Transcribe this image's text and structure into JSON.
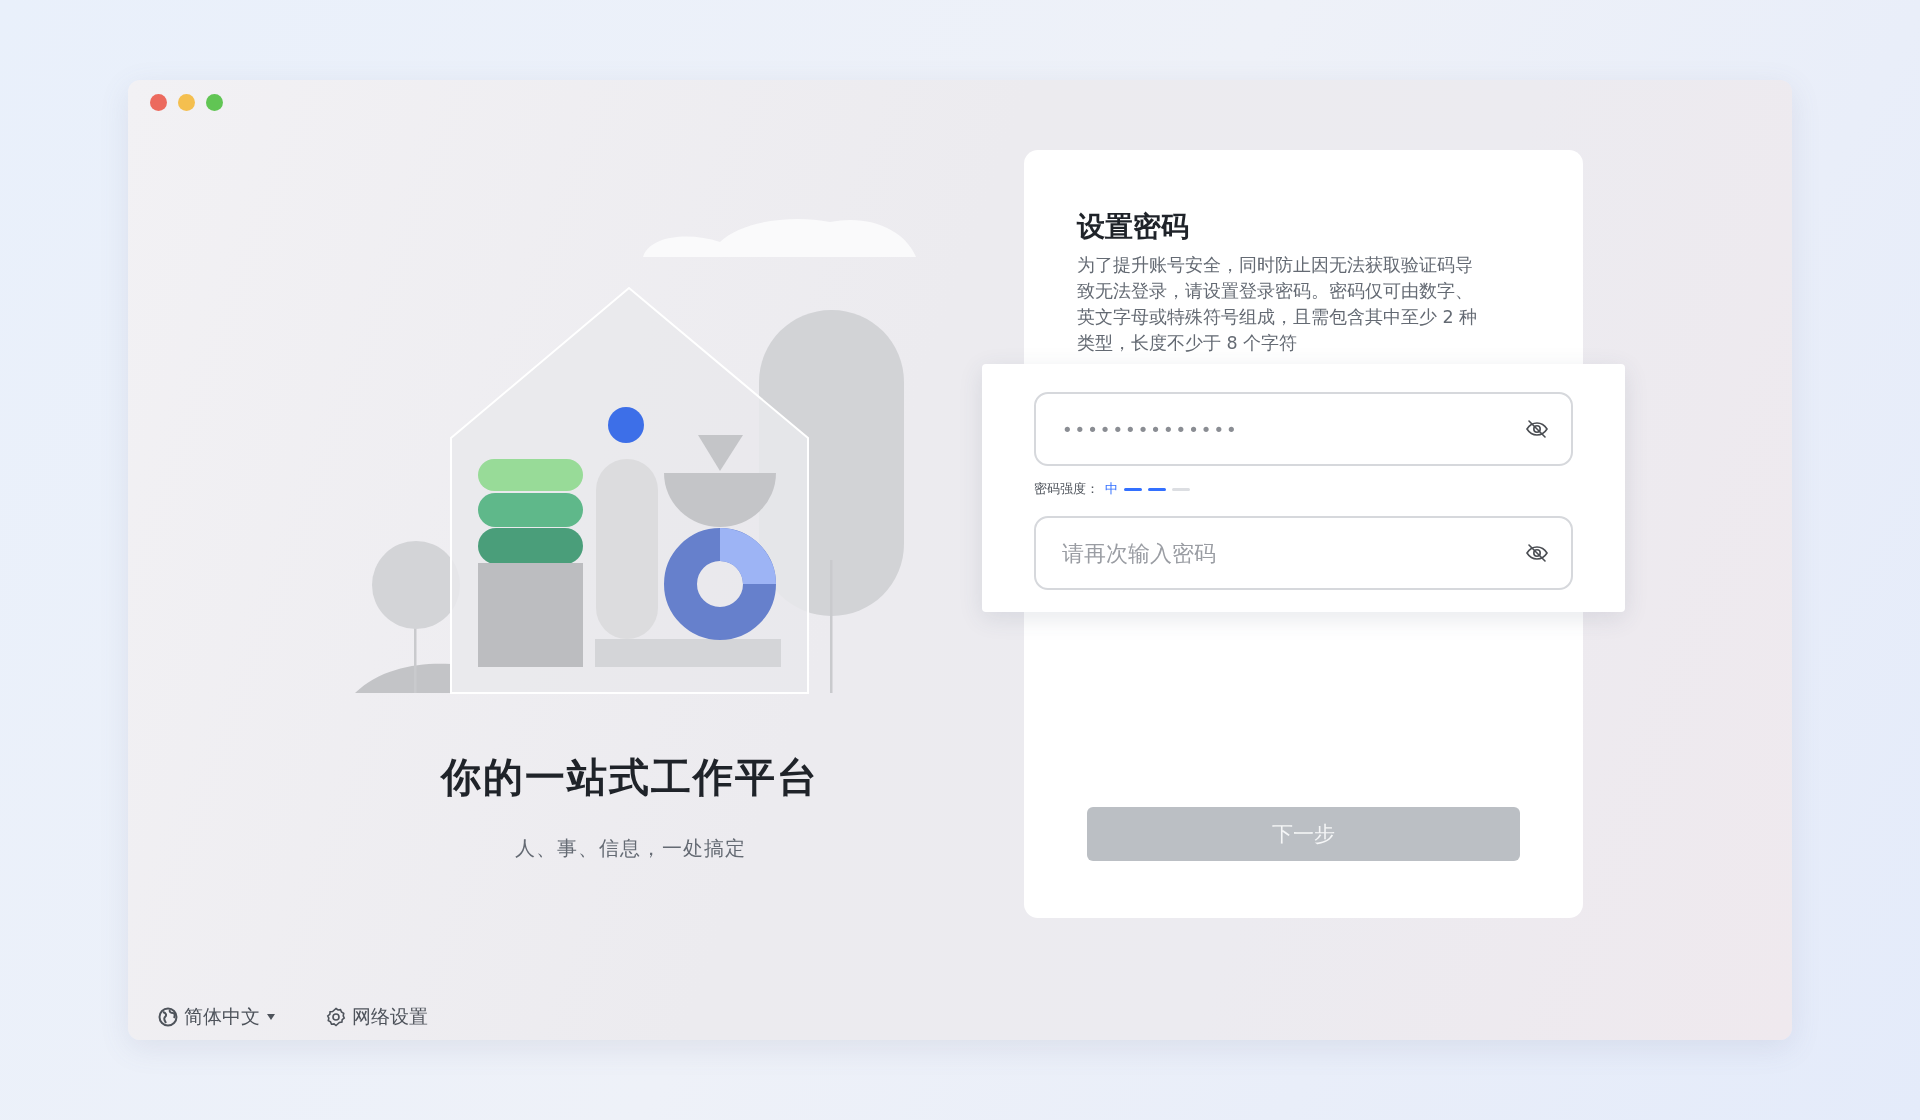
{
  "window": {
    "controls": [
      {
        "color": "#ec6a5e"
      },
      {
        "color": "#f4bf4f"
      },
      {
        "color": "#61c554"
      }
    ]
  },
  "hero": {
    "title": "你的一站式工作平台",
    "subtitle": "人、事、信息，一处搞定"
  },
  "form": {
    "title": "设置密码",
    "description": "为了提升账号安全，同时防止因无法获取验证码导致无法登录，请设置登录密码。密码仅可由数字、英文字母或特殊符号组成，且需包含其中至少 2 种类型，长度不少于 8 个字符",
    "password": {
      "value": "••••••••••••••"
    },
    "strength": {
      "label": "密码强度：",
      "value": "中",
      "segments": [
        {
          "on": true
        },
        {
          "on": true
        },
        {
          "on": false
        }
      ]
    },
    "confirm": {
      "placeholder": "请再次输入密码"
    },
    "next_button": {
      "label": "下一步",
      "disabled": true
    }
  },
  "footer": {
    "language": "简体中文",
    "network": "网络设置"
  }
}
